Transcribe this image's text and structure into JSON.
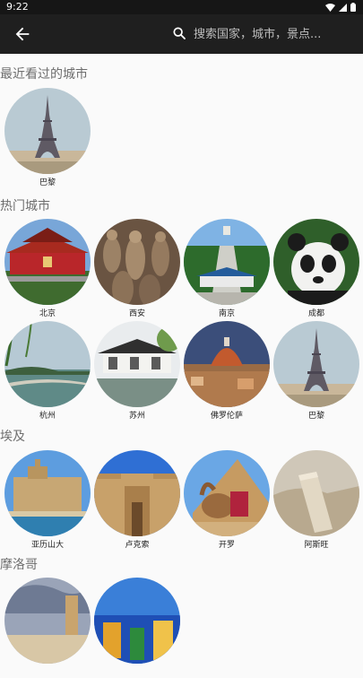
{
  "status_bar": {
    "time": "9:22"
  },
  "search": {
    "placeholder": "搜索国家，城市，景点..."
  },
  "sections": {
    "recent": {
      "title": "最近看过的城市",
      "cities": [
        "巴黎"
      ]
    },
    "hot": {
      "title": "热门城市",
      "cities": [
        "北京",
        "西安",
        "南京",
        "成都",
        "杭州",
        "苏州",
        "佛罗伦萨",
        "巴黎"
      ]
    },
    "egypt": {
      "title": "埃及",
      "cities": [
        "亚历山大",
        "卢克索",
        "开罗",
        "阿斯旺"
      ]
    },
    "morocco": {
      "title": "摩洛哥"
    }
  }
}
